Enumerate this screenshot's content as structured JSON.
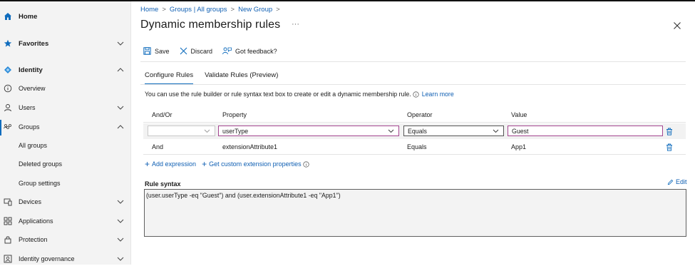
{
  "sidebar": {
    "items": [
      {
        "label": "Home",
        "icon": "home-icon",
        "bold": true
      },
      {
        "label": "Favorites",
        "icon": "star-icon",
        "bold": true
      },
      {
        "label": "Identity",
        "icon": "identity-diamond-icon",
        "bold": true
      },
      {
        "label": "Overview",
        "icon": "info-circle-icon"
      },
      {
        "label": "Users",
        "icon": "person-icon"
      },
      {
        "label": "Groups",
        "icon": "groups-icon"
      },
      {
        "label": "All groups"
      },
      {
        "label": "Deleted groups"
      },
      {
        "label": "Group settings"
      },
      {
        "label": "Devices",
        "icon": "devices-icon"
      },
      {
        "label": "Applications",
        "icon": "applications-grid-icon"
      },
      {
        "label": "Protection",
        "icon": "lock-icon"
      },
      {
        "label": "Identity governance",
        "icon": "governance-icon"
      }
    ]
  },
  "breadcrumb": {
    "items": [
      "Home",
      "Groups | All groups",
      "New Group"
    ],
    "separator": ">"
  },
  "page": {
    "title": "Dynamic membership rules",
    "more": "···"
  },
  "toolbar": {
    "save": "Save",
    "discard": "Discard",
    "feedback": "Got feedback?"
  },
  "tabs": [
    "Configure Rules",
    "Validate Rules (Preview)"
  ],
  "description": {
    "text": "You can use the rule builder or rule syntax text box to create or edit a dynamic membership rule.",
    "link": "Learn more"
  },
  "table": {
    "headers": [
      "And/Or",
      "Property",
      "Operator",
      "Value"
    ],
    "row1": {
      "andor": "",
      "property": "userType",
      "operator": "Equals",
      "value": "Guest"
    },
    "row2": {
      "andor": "And",
      "property": "extensionAttribute1",
      "operator": "Equals",
      "value": "App1"
    }
  },
  "actions": {
    "add_expression": "Add expression",
    "get_custom": "Get custom extension properties"
  },
  "rule_syntax": {
    "label": "Rule syntax",
    "edit": "Edit",
    "text": "(user.userType -eq \"Guest\") and (user.extensionAttribute1 -eq \"App1\")"
  },
  "colors": {
    "accent": "#0f6cbd",
    "link": "#0f5fb3",
    "pink_border": "#a3458f"
  }
}
